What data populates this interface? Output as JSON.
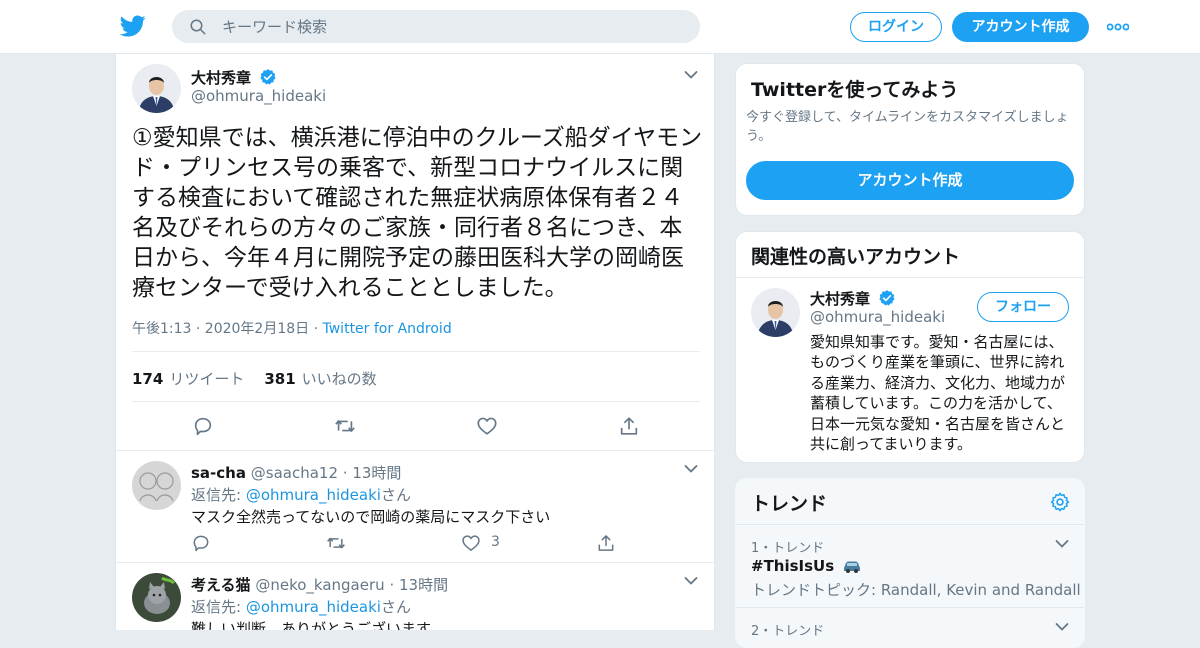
{
  "header": {
    "search_placeholder": "キーワード検索",
    "login_label": "ログイン",
    "signup_label": "アカウント作成"
  },
  "tweet": {
    "author_name": "大村秀章",
    "author_handle": "@ohmura_hideaki",
    "text": "①愛知県では、横浜港に停泊中のクルーズ船ダイヤモンド・プリンセス号の乗客で、新型コロナウイルスに関する検査において確認された無症状病原体保有者２４名及びそれらの方々のご家族・同行者８名につき、本日から、今年４月に開院予定の藤田医科大学の岡崎医療センターで受け入れることとしました。",
    "time": "午後1:13 · 2020年2月18日",
    "meta_sep": " · ",
    "source": "Twitter for Android",
    "retweet_count": "174",
    "retweet_label": "リツイート",
    "like_count": "381",
    "like_label": "いいねの数"
  },
  "replies": [
    {
      "name": "sa-cha",
      "handle": "@saacha12",
      "time": "13時間",
      "reply_prefix": "返信先: ",
      "reply_mention": "@ohmura_hideaki",
      "reply_suffix": "さん",
      "text": "マスク全然売ってないので岡崎の薬局にマスク下さい",
      "likes": "3"
    },
    {
      "name": "考える猫",
      "handle": "@neko_kangaeru",
      "time": "13時間",
      "reply_prefix": "返信先: ",
      "reply_mention": "@ohmura_hideaki",
      "reply_suffix": "さん",
      "text": "難しい判断、ありがとうございます。"
    }
  ],
  "sidebar": {
    "signup_card": {
      "title": "Twitterを使ってみよう",
      "description": "今すぐ登録して、タイムラインをカスタマイズしましょう。",
      "button": "アカウント作成"
    },
    "related": {
      "title": "関連性の高いアカウント",
      "name": "大村秀章",
      "handle": "@ohmura_hideaki",
      "follow_label": "フォロー",
      "bio": "愛知県知事です。愛知・名古屋には、ものづくり産業を筆頭に、世界に誇れる産業力、経済力、文化力、地域力が蓄積しています。この力を活かして、日本一元気な愛知・名古屋を皆さんと共に創ってまいります。"
    },
    "trends": {
      "title": "トレンド",
      "items": [
        {
          "rank": "1・トレンド",
          "tag": "#ThisIsUs",
          "topic": "トレンドトピック: Randall, Kevin and Randall"
        },
        {
          "rank": "2・トレンド"
        }
      ]
    }
  },
  "colors": {
    "accent": "#1da1f2",
    "link": "#1b95e0",
    "background": "#e6ecf0"
  }
}
